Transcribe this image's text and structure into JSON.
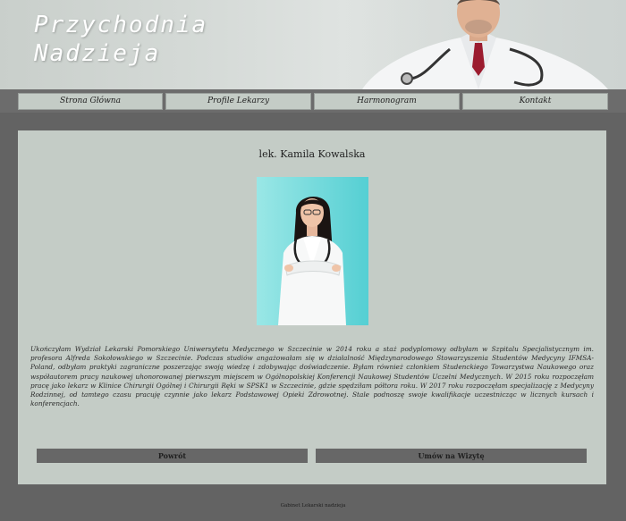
{
  "header": {
    "brand_line1": "Przychodnia",
    "brand_line2": "Nadzieja"
  },
  "nav": {
    "items": [
      {
        "label": "Strona Główna"
      },
      {
        "label": "Profile Lekarzy"
      },
      {
        "label": "Harmonogram"
      },
      {
        "label": "Kontakt"
      }
    ]
  },
  "profile": {
    "name": "lek. Kamila Kowalska",
    "bio": "Ukończyłam Wydział Lekarski Pomorskiego Uniwersytetu Medycznego w Szczecinie w 2014 roku a staż podyplomowy odbyłam w Szpitalu Specjalistycznym im. profesora Alfreda Sokołowskiego w Szczecinie. Podczas studiów angażowałam się w działalność Międzynarodowego Stowarzyszenia Studentów Medycyny IFMSA-Poland, odbyłam praktyki zagraniczne poszerzając swoją wiedzę i zdobywając doświadczenie. Byłam również członkiem Studenckiego Towarzystwa Naukowego oraz współautorem pracy naukowej uhonorowanej pierwszym miejscem w Ogólnopolskiej Konferencji Naukowej Studentów Uczelni Medycznych. W 2015 roku rozpoczęłam pracę jako lekarz w Klinice Chirurgii Ogólnej i Chirurgii Ręki w SPSK1 w Szczecinie, gdzie spędziłam półtora roku. W 2017 roku rozpoczęłam specjalizację z Medycyny Rodzinnej, od tamtego czasu pracuję czynnie jako lekarz Podstawowej Opieki Zdrowotnej. Stale podnoszę swoje kwalifikacje uczestnicząc w licznych kursach i konferencjach."
  },
  "actions": {
    "back_label": "Powrót",
    "book_label": "Umów na Wizytę"
  },
  "footer": {
    "text": "Gabinet Lekarski nadzieja"
  },
  "colors": {
    "page_bg": "#636363",
    "panel_bg": "#c4ccc6",
    "button_bg": "#676767",
    "portrait_bg": "#7fdcdc"
  }
}
